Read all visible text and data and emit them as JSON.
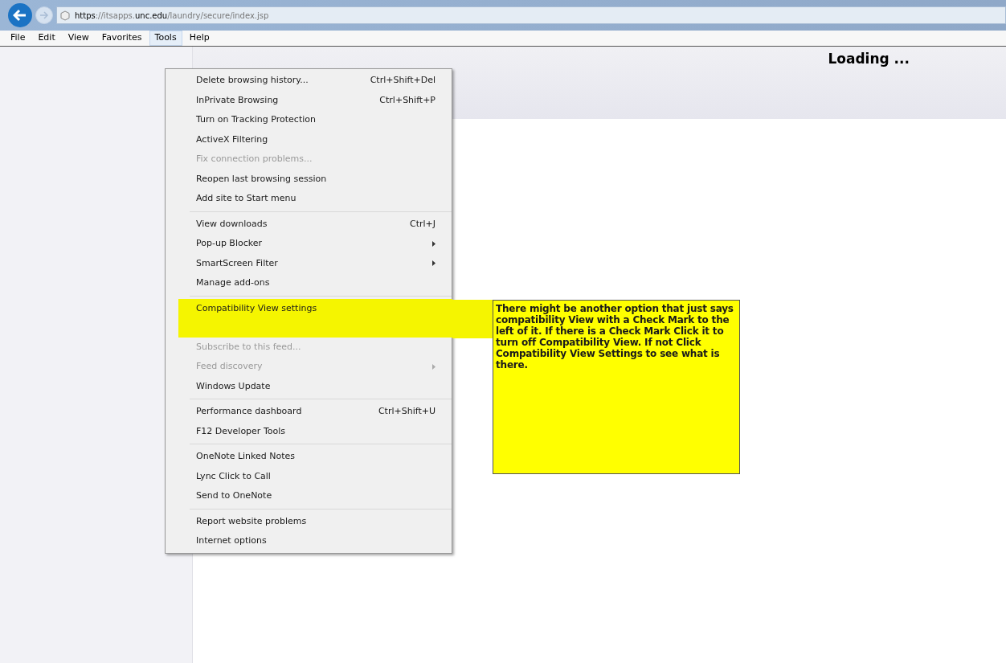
{
  "address_bar": {
    "scheme": "https",
    "prefix": "://itsapps.",
    "domain": "unc.edu",
    "path": "/laundry/secure/index.jsp"
  },
  "menu_bar": [
    {
      "label": "File",
      "selected": false
    },
    {
      "label": "Edit",
      "selected": false
    },
    {
      "label": "View",
      "selected": false
    },
    {
      "label": "Favorites",
      "selected": false
    },
    {
      "label": "Tools",
      "selected": true
    },
    {
      "label": "Help",
      "selected": false
    }
  ],
  "page": {
    "status": "Loading ..."
  },
  "tools_menu": [
    [
      {
        "label": "Delete browsing history...",
        "shortcut": "Ctrl+Shift+Del",
        "disabled": false,
        "submenu": false,
        "highlighted": false
      },
      {
        "label": "InPrivate Browsing",
        "shortcut": "Ctrl+Shift+P",
        "disabled": false,
        "submenu": false,
        "highlighted": false
      },
      {
        "label": "Turn on Tracking Protection",
        "disabled": false,
        "submenu": false,
        "highlighted": false
      },
      {
        "label": "ActiveX Filtering",
        "disabled": false,
        "submenu": false,
        "highlighted": false
      },
      {
        "label": "Fix connection problems...",
        "disabled": true,
        "submenu": false,
        "highlighted": false
      },
      {
        "label": "Reopen last browsing session",
        "disabled": false,
        "submenu": false,
        "highlighted": false
      },
      {
        "label": "Add site to Start menu",
        "disabled": false,
        "submenu": false,
        "highlighted": false
      }
    ],
    [
      {
        "label": "View downloads",
        "shortcut": "Ctrl+J",
        "disabled": false,
        "submenu": false,
        "highlighted": false
      },
      {
        "label": "Pop-up Blocker",
        "disabled": false,
        "submenu": true,
        "highlighted": false
      },
      {
        "label": "SmartScreen Filter",
        "disabled": false,
        "submenu": true,
        "highlighted": false
      },
      {
        "label": "Manage add-ons",
        "disabled": false,
        "submenu": false,
        "highlighted": false
      }
    ],
    [
      {
        "label": "Compatibility View settings",
        "disabled": false,
        "submenu": false,
        "highlighted": true
      },
      {
        "label": "Subscribe to this feed...",
        "disabled": true,
        "submenu": false,
        "highlighted": false
      },
      {
        "label": "Feed discovery",
        "disabled": true,
        "submenu": true,
        "highlighted": false
      },
      {
        "label": "Windows Update",
        "disabled": false,
        "submenu": false,
        "highlighted": false
      }
    ],
    [
      {
        "label": "Performance dashboard",
        "shortcut": "Ctrl+Shift+U",
        "disabled": false,
        "submenu": false,
        "highlighted": false
      },
      {
        "label": "F12 Developer Tools",
        "disabled": false,
        "submenu": false,
        "highlighted": false
      }
    ],
    [
      {
        "label": "OneNote Linked Notes",
        "disabled": false,
        "submenu": false,
        "highlighted": false
      },
      {
        "label": "Lync Click to Call",
        "disabled": false,
        "submenu": false,
        "highlighted": false
      },
      {
        "label": "Send to OneNote",
        "disabled": false,
        "submenu": false,
        "highlighted": false
      }
    ],
    [
      {
        "label": "Report website problems",
        "disabled": false,
        "submenu": false,
        "highlighted": false
      },
      {
        "label": "Internet options",
        "disabled": false,
        "submenu": false,
        "highlighted": false
      }
    ]
  ],
  "callout": {
    "text": "There might be another option that just says compatibility View with a Check Mark to the left of it.  If there is a Check Mark Click it to turn off Compatibility View.  If not Click Compatibility View Settings to see what is there."
  }
}
